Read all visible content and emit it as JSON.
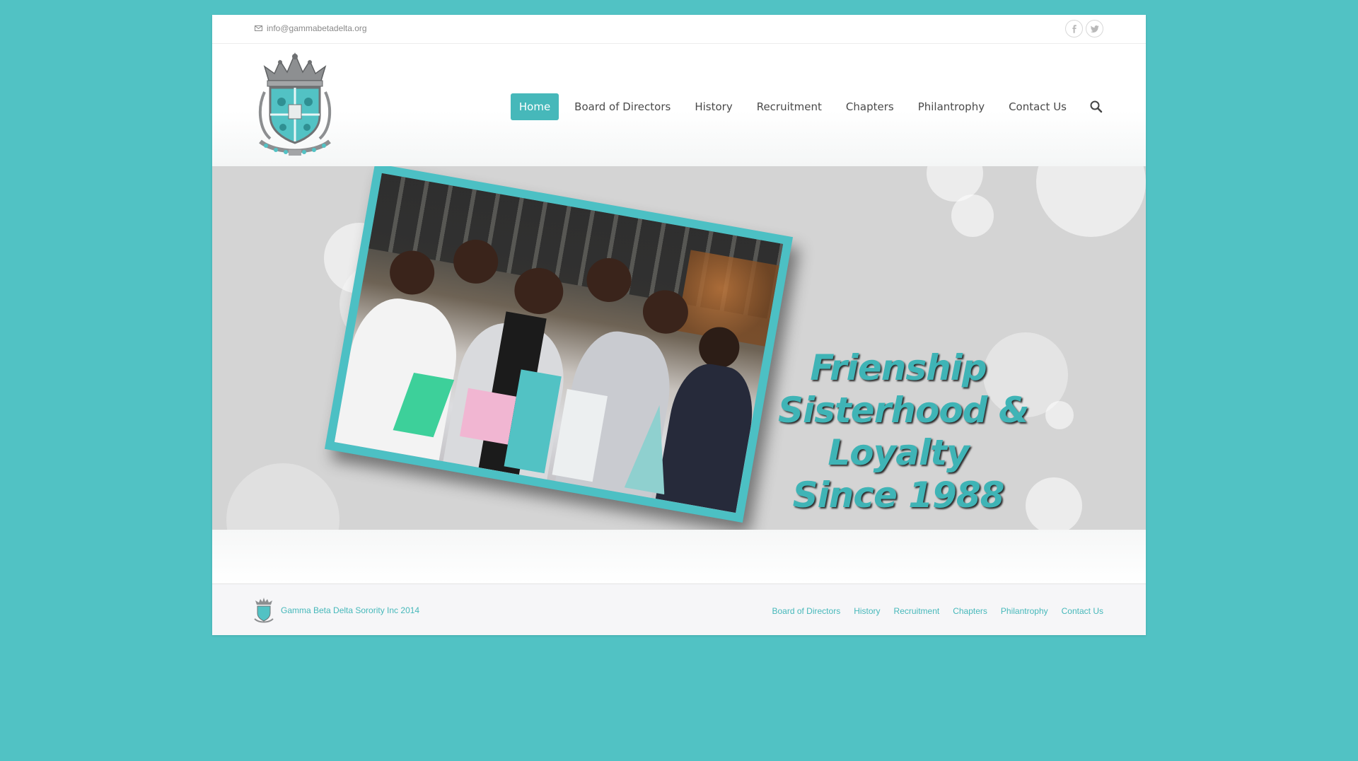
{
  "topbar": {
    "email": "info@gammabetadelta.org",
    "social": [
      {
        "icon": "facebook-icon",
        "glyph": "f"
      },
      {
        "icon": "twitter-icon",
        "glyph": "t"
      }
    ]
  },
  "nav": {
    "items": [
      {
        "label": "Home",
        "active": true
      },
      {
        "label": "Board of Directors"
      },
      {
        "label": "History"
      },
      {
        "label": "Recruitment"
      },
      {
        "label": "Chapters"
      },
      {
        "label": "Philantrophy"
      },
      {
        "label": "Contact Us"
      }
    ]
  },
  "hero": {
    "lines": [
      "Frienship",
      "Sisterhood &",
      "Loyalty",
      "Since 1988"
    ]
  },
  "footer": {
    "copyright": "Gamma Beta Delta Sorority Inc 2014",
    "links": [
      "Board of Directors",
      "History",
      "Recruitment",
      "Chapters",
      "Philantrophy",
      "Contact Us"
    ]
  },
  "colors": {
    "background": "#51c2c4",
    "accent": "#46b8ba",
    "hero_bg": "#d4d4d4"
  }
}
